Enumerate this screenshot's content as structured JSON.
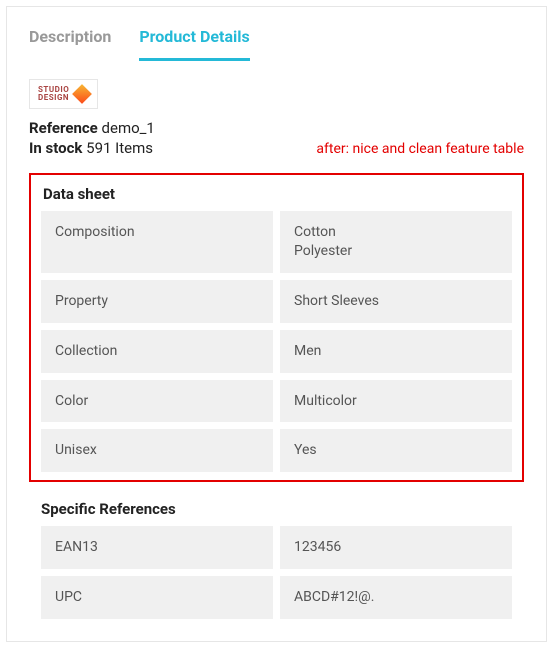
{
  "tabs": {
    "description": "Description",
    "details": "Product Details"
  },
  "brand": {
    "line1": "STUDIO",
    "line2": "DESIGN"
  },
  "reference": {
    "label": "Reference",
    "value": "demo_1"
  },
  "stock": {
    "label": "In stock",
    "value": "591 Items"
  },
  "annotation": "after: nice and clean feature table",
  "datasheet": {
    "title": "Data sheet",
    "rows": [
      {
        "name": "Composition",
        "value": "Cotton\nPolyester"
      },
      {
        "name": "Property",
        "value": "Short Sleeves"
      },
      {
        "name": "Collection",
        "value": "Men"
      },
      {
        "name": "Color",
        "value": "Multicolor"
      },
      {
        "name": "Unisex",
        "value": "Yes"
      }
    ]
  },
  "specific": {
    "title": "Specific References",
    "rows": [
      {
        "name": "EAN13",
        "value": "123456"
      },
      {
        "name": "UPC",
        "value": "ABCD#12!@."
      }
    ]
  }
}
